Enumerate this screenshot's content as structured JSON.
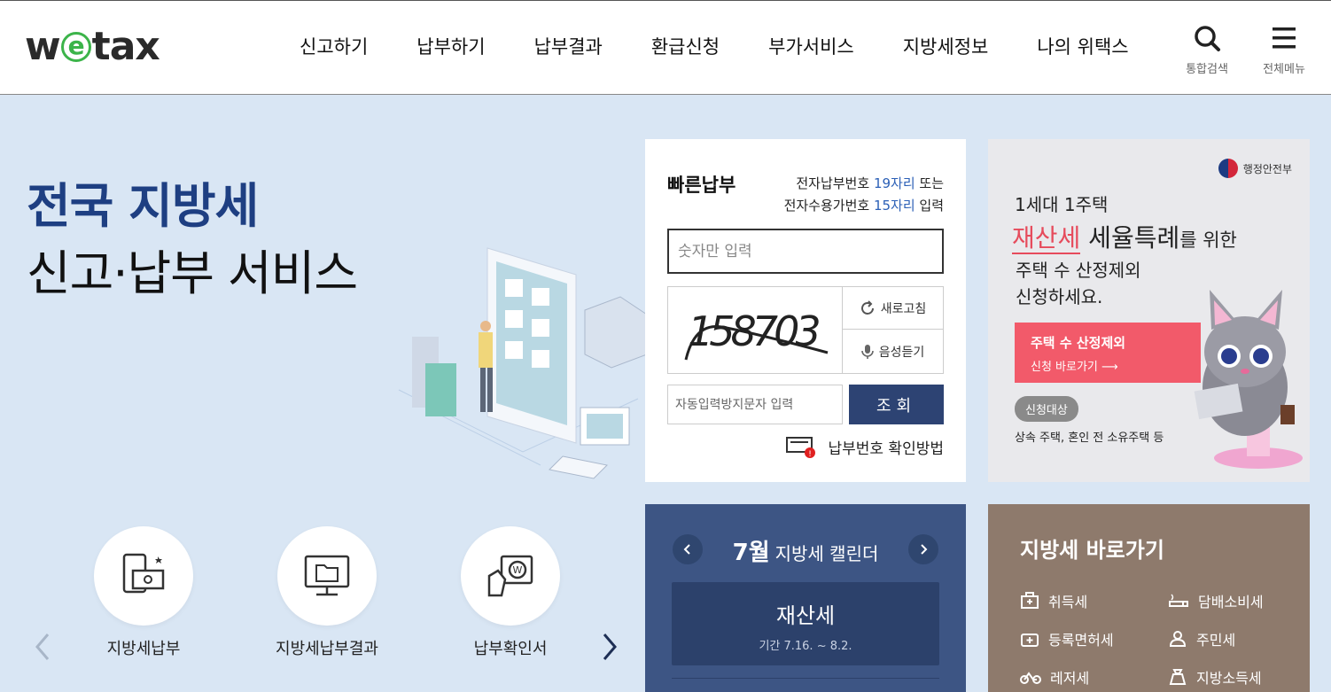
{
  "header": {
    "logo": {
      "w": "w",
      "e": "e",
      "rest": "tax"
    },
    "nav": [
      "신고하기",
      "납부하기",
      "납부결과",
      "환급신청",
      "부가서비스",
      "지방세정보",
      "나의 위택스"
    ],
    "search_label": "통합검색",
    "menu_label": "전체메뉴"
  },
  "hero": {
    "line1": "전국 지방세",
    "line2": "신고·납부 서비스"
  },
  "services": {
    "items": [
      {
        "label": "지방세납부",
        "icon": "mobile-payment-icon"
      },
      {
        "label": "지방세납부결과",
        "icon": "monitor-folder-icon"
      },
      {
        "label": "납부확인서",
        "icon": "hand-ticket-icon"
      }
    ]
  },
  "quick_pay": {
    "title": "빠른납부",
    "desc": {
      "l1_a": "전자납부번호 ",
      "l1_hl": "19자리",
      "l1_b": " 또는",
      "l2_a": "전자수용가번호 ",
      "l2_hl": "15자리",
      "l2_b": " 입력"
    },
    "number_placeholder": "숫자만 입력",
    "captcha_text": "158703",
    "refresh_label": "새로고침",
    "audio_label": "음성듣기",
    "auto_placeholder": "자동입력방지문자 입력",
    "search_button": "조회",
    "confirm_link": "납부번호 확인방법"
  },
  "banner": {
    "ministry": "행정안전부",
    "line1": "1세대 1주택",
    "line2_red": "재산세",
    "line2_a": " 세율특례",
    "line2_b": "를 위한",
    "line3": "주택 수 산정제외",
    "line4": "신청하세요.",
    "cta_title": "주택 수 산정제외",
    "cta_sub": "신청 바로가기",
    "tag": "신청대상",
    "sub": "상속 주택, 혼인 전 소유주택 등"
  },
  "calendar": {
    "month": "7월",
    "title": "지방세 캘린더",
    "tax_name": "재산세",
    "period": "기간 7.16. ~ 8.2."
  },
  "shortcuts": {
    "title": "지방세 바로가기",
    "items": [
      {
        "label": "취득세",
        "icon": "briefcase-icon"
      },
      {
        "label": "담배소비세",
        "icon": "cigarette-icon"
      },
      {
        "label": "등록면허세",
        "icon": "plus-bag-icon"
      },
      {
        "label": "주민세",
        "icon": "person-icon"
      },
      {
        "label": "레저세",
        "icon": "bicycle-icon"
      },
      {
        "label": "지방소득세",
        "icon": "money-bag-icon"
      }
    ]
  },
  "colors": {
    "brand_navy": "#2d4373",
    "accent_blue": "#2b5fb6",
    "logo_green": "#3cb44a",
    "banner_red": "#f25a6a",
    "calendar_bg": "#3d5584",
    "shortcut_bg": "#8e7a6c"
  }
}
